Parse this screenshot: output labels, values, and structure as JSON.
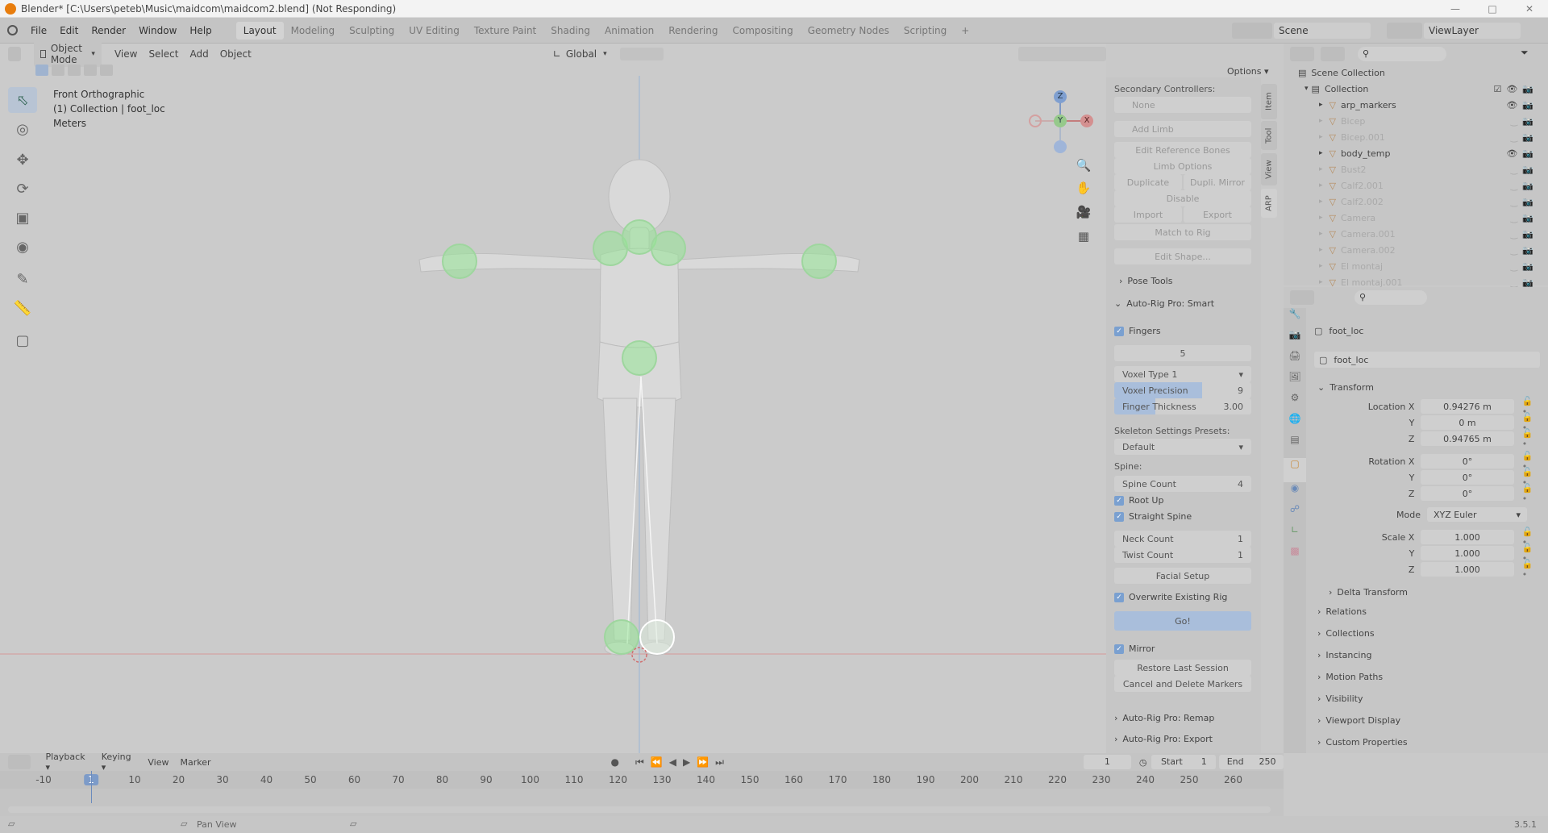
{
  "window": {
    "title": "Blender* [C:\\Users\\peteb\\Music\\maidcom\\maidcom2.blend] (Not Responding)"
  },
  "menubar": {
    "menus": [
      "File",
      "Edit",
      "Render",
      "Window",
      "Help"
    ],
    "workspaces": [
      "Layout",
      "Modeling",
      "Sculpting",
      "UV Editing",
      "Texture Paint",
      "Shading",
      "Animation",
      "Rendering",
      "Compositing",
      "Geometry Nodes",
      "Scripting"
    ],
    "add_workspace": "+",
    "scene_label": "Scene",
    "viewlayer_label": "ViewLayer"
  },
  "viewport_header": {
    "mode": "Object Mode",
    "menus": [
      "View",
      "Select",
      "Add",
      "Object"
    ],
    "transform_orientation": "Global",
    "options_label": "Options"
  },
  "viewport_overlay": {
    "line1": "Front Orthographic",
    "line2": "(1) Collection | foot_loc",
    "line3": "Meters"
  },
  "gizmo": {
    "z": "Z",
    "y": "Y",
    "x": "X"
  },
  "npanel": {
    "tabs": [
      "Item",
      "Tool",
      "View",
      "ARP"
    ],
    "secondary_controllers_label": "Secondary Controllers:",
    "secondary_controllers_value": "None",
    "add_limb": "Add Limb",
    "edit_reference_bones": "Edit Reference Bones",
    "limb_options": "Limb Options",
    "duplicate": "Duplicate",
    "dupli_mirror": "Dupli. Mirror",
    "disable": "Disable",
    "import": "Import",
    "export": "Export",
    "match_to_rig": "Match to Rig",
    "edit_shape": "Edit Shape...",
    "pose_tools": "Pose Tools",
    "smart_header": "Auto-Rig Pro: Smart",
    "fingers_label": "Fingers",
    "fingers_value": "5",
    "voxel_type": "Voxel Type 1",
    "voxel_precision_label": "Voxel Precision",
    "voxel_precision_value": "9",
    "finger_thickness_label": "Finger Thickness",
    "finger_thickness_value": "3.00",
    "skeleton_presets_label": "Skeleton Settings Presets:",
    "skeleton_presets_value": "Default",
    "spine_label": "Spine:",
    "spine_count_label": "Spine Count",
    "spine_count_value": "4",
    "root_up": "Root Up",
    "straight_spine": "Straight Spine",
    "neck_count_label": "Neck Count",
    "neck_count_value": "1",
    "twist_count_label": "Twist Count",
    "twist_count_value": "1",
    "facial_setup": "Facial Setup",
    "overwrite_existing_rig": "Overwrite Existing Rig",
    "go": "Go!",
    "mirror": "Mirror",
    "restore_last_session": "Restore Last Session",
    "cancel_delete_markers": "Cancel and Delete Markers",
    "remap_header": "Auto-Rig Pro: Remap",
    "export_header": "Auto-Rig Pro: Export"
  },
  "outliner": {
    "scene_collection": "Scene Collection",
    "collection": "Collection",
    "items": [
      {
        "name": "arp_markers",
        "visible": true
      },
      {
        "name": "Bicep",
        "visible": false
      },
      {
        "name": "Bicep.001",
        "visible": false
      },
      {
        "name": "body_temp",
        "visible": true
      },
      {
        "name": "Bust2",
        "visible": false
      },
      {
        "name": "Calf2.001",
        "visible": false
      },
      {
        "name": "Calf2.002",
        "visible": false
      },
      {
        "name": "Camera",
        "visible": false
      },
      {
        "name": "Camera.001",
        "visible": false
      },
      {
        "name": "Camera.002",
        "visible": false
      },
      {
        "name": "El montaj",
        "visible": false
      },
      {
        "name": "El montaj.001",
        "visible": false
      }
    ]
  },
  "properties": {
    "object_name": "foot_loc",
    "datablock_name": "foot_loc",
    "transform_header": "Transform",
    "location_x_label": "Location X",
    "location_x": "0.94276 m",
    "location_y_label": "Y",
    "location_y": "0 m",
    "location_z_label": "Z",
    "location_z": "0.94765 m",
    "rotation_x_label": "Rotation X",
    "rotation_x": "0°",
    "rotation_y_label": "Y",
    "rotation_y": "0°",
    "rotation_z_label": "Z",
    "rotation_z": "0°",
    "mode_label": "Mode",
    "mode_value": "XYZ Euler",
    "scale_x_label": "Scale X",
    "scale_x": "1.000",
    "scale_y_label": "Y",
    "scale_y": "1.000",
    "scale_z_label": "Z",
    "scale_z": "1.000",
    "delta_transform": "Delta Transform",
    "sections": [
      "Relations",
      "Collections",
      "Instancing",
      "Motion Paths",
      "Visibility",
      "Viewport Display",
      "Custom Properties"
    ]
  },
  "timeline": {
    "menus": [
      "Playback",
      "Keying",
      "View",
      "Marker"
    ],
    "current_frame": "1",
    "start_label": "Start",
    "start_value": "1",
    "end_label": "End",
    "end_value": "250",
    "ruler": [
      "-10",
      "1",
      "10",
      "20",
      "30",
      "40",
      "50",
      "60",
      "70",
      "80",
      "90",
      "100",
      "110",
      "120",
      "130",
      "140",
      "150",
      "160",
      "170",
      "180",
      "190",
      "200",
      "210",
      "220",
      "230",
      "240",
      "250",
      "260"
    ]
  },
  "statusbar": {
    "pan_view": "Pan View",
    "version": "3.5.1"
  }
}
